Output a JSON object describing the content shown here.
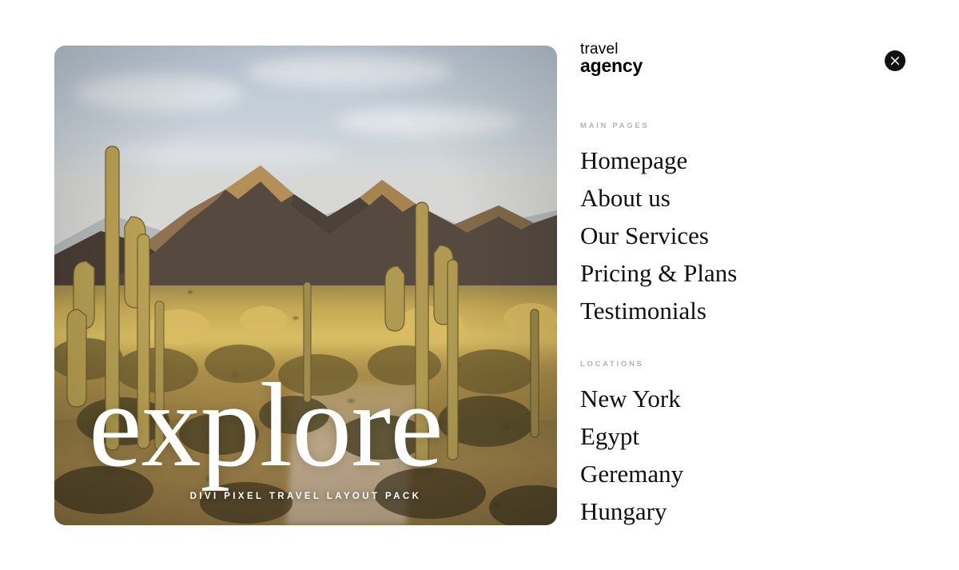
{
  "brand": {
    "line_1": "travel",
    "line_2": "agency"
  },
  "close_button": {
    "icon": "close-icon",
    "label": "Close"
  },
  "hero_card": {
    "headline": "explore",
    "caption": "DIVI PIXEL TRAVEL LAYOUT PACK",
    "scene": "sonoran desert with saguaro cacti and mountains at golden hour"
  },
  "nav": {
    "sections": [
      {
        "label": "MAIN PAGES",
        "items": [
          {
            "label": "Homepage"
          },
          {
            "label": "About us"
          },
          {
            "label": "Our Services"
          },
          {
            "label": "Pricing & Plans"
          },
          {
            "label": "Testimonials"
          }
        ]
      },
      {
        "label": "LOCATIONS",
        "items": [
          {
            "label": "New York"
          },
          {
            "label": "Egypt"
          },
          {
            "label": "Geremany"
          },
          {
            "label": "Hungary"
          }
        ]
      }
    ]
  },
  "colors": {
    "page_background": "#ffffff",
    "text_primary": "#111111",
    "label_gray": "#b3b3b3",
    "close_button": "#111111",
    "card_overlay_text": "#ffffff"
  }
}
